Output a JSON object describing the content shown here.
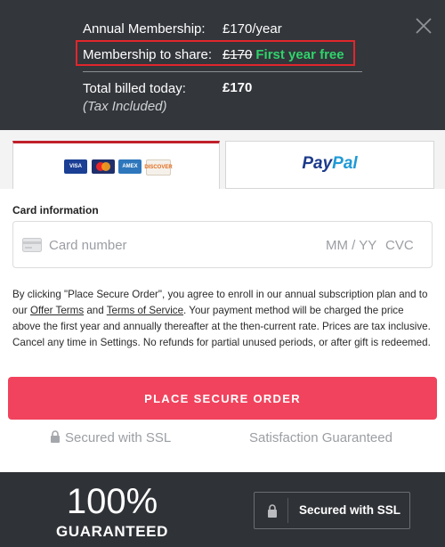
{
  "summary": {
    "annual_label": "Annual Membership:",
    "annual_value": "£170/year",
    "share_label": "Membership to share:",
    "share_old_price": "£170",
    "share_promo": "First year free",
    "total_label": "Total billed today:",
    "total_value": "£170",
    "tax_note": "(Tax Included)"
  },
  "tabs": {
    "card_logos": [
      "VISA",
      "mastercard",
      "AMEX",
      "DISCOVER"
    ],
    "paypal_a": "Pay",
    "paypal_b": "Pal"
  },
  "card": {
    "label": "Card information",
    "number_placeholder": "Card number",
    "expiry_placeholder": "MM / YY",
    "cvc_placeholder": "CVC"
  },
  "legal": {
    "part1": "By clicking \"Place Secure Order\", you agree to enroll in our annual subscription plan and to our ",
    "offer_terms": "Offer Terms",
    "and": " and ",
    "tos": "Terms of Service",
    "part2": ". Your payment method will be charged the price above the first year and annually thereafter at the then-current rate. Prices are tax inclusive. Cancel any time in Settings. No refunds for partial unused periods, or after gift is redeemed."
  },
  "order_button": "PLACE SECURE ORDER",
  "secured_ssl": "Secured with SSL",
  "satisfaction": "Satisfaction Guaranteed",
  "footer": {
    "big": "100%",
    "guaranteed": "GUARANTEED",
    "ssl_badge": "Secured with SSL"
  },
  "colors": {
    "header_bg": "#33363b",
    "promo_green": "#2fd36b",
    "highlight_red": "#e0262b",
    "button_pink": "#f1435d",
    "footer_bg": "#2f3236"
  }
}
